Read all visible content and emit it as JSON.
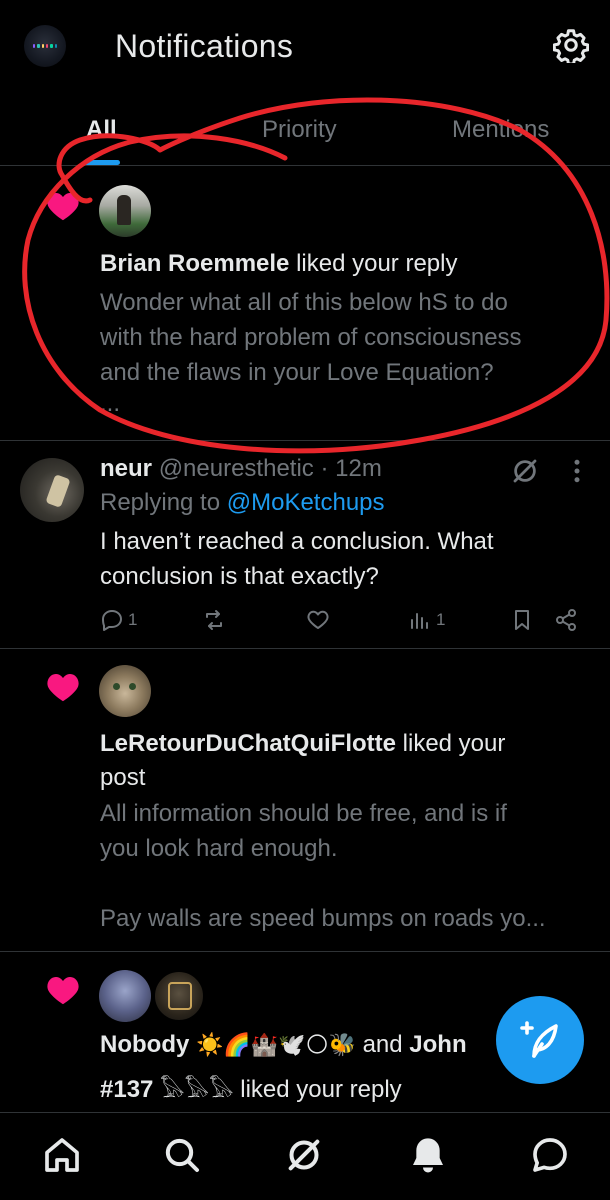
{
  "header": {
    "title": "Notifications",
    "settings_icon": "gear-icon"
  },
  "tabs": [
    {
      "label": "All",
      "active": true
    },
    {
      "label": "Priority",
      "active": false
    },
    {
      "label": "Mentions",
      "active": false
    }
  ],
  "notifications": [
    {
      "type": "like",
      "user": "Brian Roemmele",
      "action": "liked your reply",
      "body": [
        "Wonder what all of this below hS to do",
        "with the hard problem of consciousness",
        "and the flaws in your Love Equation?",
        "..."
      ]
    },
    {
      "type": "like",
      "user": "LeRetourDuChatQuiFlotte",
      "action_line1": "liked your",
      "action_line2": "post",
      "body": [
        "All information should be free, and is if",
        "you look hard enough.",
        "",
        "Pay walls are speed bumps on roads yo..."
      ]
    },
    {
      "type": "like",
      "user1": "Nobody",
      "user1_emojis": "☀️🌈🏰🕊️🌕🐝",
      "connector": "and",
      "user2": "John",
      "line2_prefix": "#137",
      "line2_emojis": "𓅃𓅃𓅃",
      "action": "liked your reply"
    }
  ],
  "tweet": {
    "name": "neur",
    "handle": "@neuresthetic",
    "time": "· 12m",
    "replying_to_label": "Replying to",
    "replying_to_user": "@MoKetchups",
    "text_line1": "I haven’t reached a conclusion. What",
    "text_line2": "conclusion is that exactly?",
    "reply_count": "1",
    "views_count": "1"
  },
  "colors": {
    "background": "#000000",
    "text": "#e7e9ea",
    "muted": "#71767b",
    "accent": "#1d9bf0",
    "heart": "#f91880",
    "annotation": "#e8262b"
  },
  "bottom_nav": [
    "home-icon",
    "search-icon",
    "grok-icon",
    "notifications-bell-icon",
    "messages-icon"
  ]
}
